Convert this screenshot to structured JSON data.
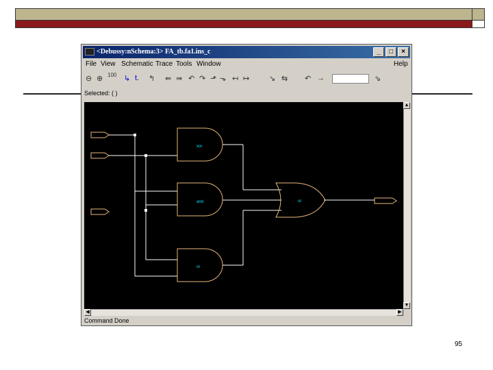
{
  "window": {
    "title": "<Debussy:nSchema:3> FA_tb.fa1.ins_c"
  },
  "menu": [
    "File",
    "View",
    "Schematic",
    "Trace",
    "Tools",
    "Window",
    "Help"
  ],
  "toolbar": {
    "tools": [
      "⊖",
      "⊕",
      "100",
      "↳",
      "t.",
      "↰",
      "⇚",
      "⇛",
      "↶",
      "↷",
      "⬏",
      "⬎",
      "↤",
      "↦",
      "↘",
      "⇆",
      "↶",
      "→"
    ]
  },
  "selected_label": "Selected: ( )",
  "status": "Command Done",
  "gates": {
    "and1_label": "xor",
    "and2_label": "and",
    "and3_label": "or",
    "or_label": "or"
  },
  "page_number": "95",
  "colors": {
    "title_start": "#0a246a",
    "title_end": "#3a6ea5",
    "gate": "#e8b87a",
    "wire": "#ffffff",
    "canvas": "#000000",
    "label": "#00e5ff",
    "header_top": "#bdb58e",
    "header_bottom": "#8b1a1a"
  }
}
